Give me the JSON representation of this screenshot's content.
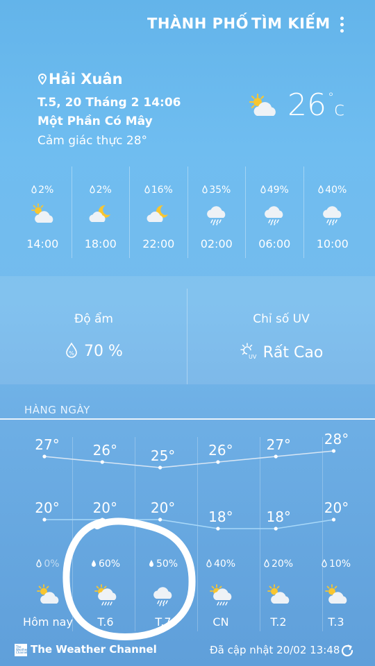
{
  "header": {
    "city_button": "THÀNH PHỐ",
    "search_button": "TÌM KIẾM",
    "menu_icon": "more-vert-icon"
  },
  "current": {
    "location": "Hải Xuân",
    "datetime": "T.5, 20 Tháng 2 14:06",
    "condition": "Một Phần Có Mây",
    "feels_like": "Cảm giác thực 28°",
    "temperature": "26",
    "unit": "c",
    "icon": "partly-cloudy-day-icon"
  },
  "hourly": [
    {
      "pop": "2%",
      "time": "14:00",
      "icon": "partly-cloudy-day-icon"
    },
    {
      "pop": "2%",
      "time": "18:00",
      "icon": "partly-cloudy-night-icon"
    },
    {
      "pop": "16%",
      "time": "22:00",
      "icon": "partly-cloudy-night-icon"
    },
    {
      "pop": "35%",
      "time": "02:00",
      "icon": "rain-cloud-icon"
    },
    {
      "pop": "49%",
      "time": "06:00",
      "icon": "rain-cloud-icon"
    },
    {
      "pop": "40%",
      "time": "10:00",
      "icon": "rain-cloud-icon"
    }
  ],
  "details": {
    "humidity_label": "Độ ẩm",
    "humidity_value": "70 %",
    "uv_label": "Chỉ số UV",
    "uv_value": "Rất Cao"
  },
  "daily": {
    "title": "HÀNG NGÀY",
    "days": [
      {
        "name": "Hôm nay",
        "high": "27°",
        "low": "20°",
        "pop": "0%",
        "icon": "partly-cloudy-day-icon"
      },
      {
        "name": "T.6",
        "high": "26°",
        "low": "20°",
        "pop": "60%",
        "icon": "sun-rain-cloud-icon"
      },
      {
        "name": "T.7",
        "high": "25°",
        "low": "20°",
        "pop": "50%",
        "icon": "rain-cloud-icon"
      },
      {
        "name": "CN",
        "high": "26°",
        "low": "18°",
        "pop": "40%",
        "icon": "sun-rain-cloud-icon"
      },
      {
        "name": "T.2",
        "high": "27°",
        "low": "18°",
        "pop": "20%",
        "icon": "partly-cloudy-day-icon"
      },
      {
        "name": "T.3",
        "high": "28°",
        "low": "20°",
        "pop": "10%",
        "icon": "partly-cloudy-day-icon"
      }
    ]
  },
  "footer": {
    "brand": "The Weather Channel",
    "logo_text": "The Weather Channel",
    "updated": "Đã cập nhật  20/02  13:48"
  },
  "colors": {
    "high_line": "#d8e6f4",
    "low_line": "#a8d8f8",
    "annotation": "#ffffff"
  }
}
